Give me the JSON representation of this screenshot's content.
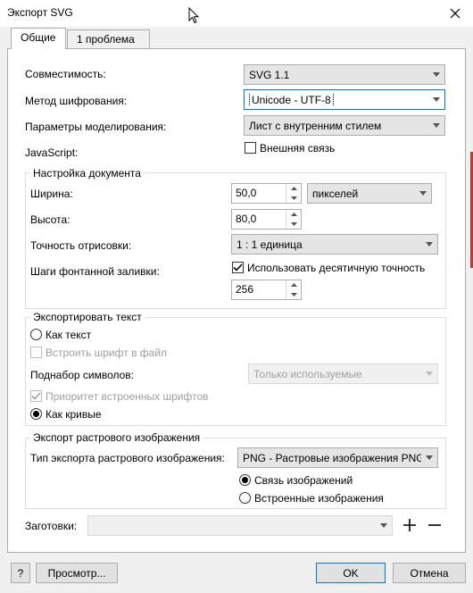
{
  "window": {
    "title": "Экспорт SVG"
  },
  "tabs": [
    {
      "label": "Общие"
    },
    {
      "label": "1 проблема"
    }
  ],
  "general": {
    "compat_label": "Совместимость:",
    "compat_value": "SVG 1.1",
    "encoding_label": "Метод шифрования:",
    "encoding_value": "Unicode - UTF-8",
    "styling_label": "Параметры моделирования:",
    "styling_value": "Лист с внутренним стилем",
    "js_label": "JavaScript:",
    "external_link_label": "Внешняя связь",
    "external_link_checked": false
  },
  "doc": {
    "legend": "Настройка документа",
    "width_label": "Ширина:",
    "width_value": "50,0",
    "units_value": "пикселей",
    "height_label": "Высота:",
    "height_value": "80,0",
    "precision_label": "Точность отрисовки:",
    "precision_value": "1 : 1 единица",
    "fountain_label": "Шаги фонтанной заливки:",
    "decimal_label": "Использовать десятичную точность",
    "decimal_checked": true,
    "steps_value": "256"
  },
  "text": {
    "legend": "Экспортировать текст",
    "as_text_label": "Как текст",
    "embed_font_label": "Встроить шрифт в файл",
    "subset_label": "Поднабор символов:",
    "subset_value": "Только используемые",
    "priority_label": "Приоритет встроенных шрифтов",
    "as_curves_label": "Как кривые",
    "selected": "as_curves"
  },
  "bitmap": {
    "legend": "Экспорт растрового изображения",
    "type_label": "Тип экспорта растрового изображения:",
    "type_value": "PNG - Растровые изображения PNG",
    "linked_label": "Связь изображений",
    "embedded_label": "Встроенные изображения",
    "selected": "linked"
  },
  "presets": {
    "label": "Заготовки:",
    "value": ""
  },
  "footer": {
    "help_label": "?",
    "preview_label": "Просмотр...",
    "ok_label": "OK",
    "cancel_label": "Отмена"
  },
  "colors": {
    "accent": "#0078d7",
    "accent_strip": "#c0392b"
  }
}
